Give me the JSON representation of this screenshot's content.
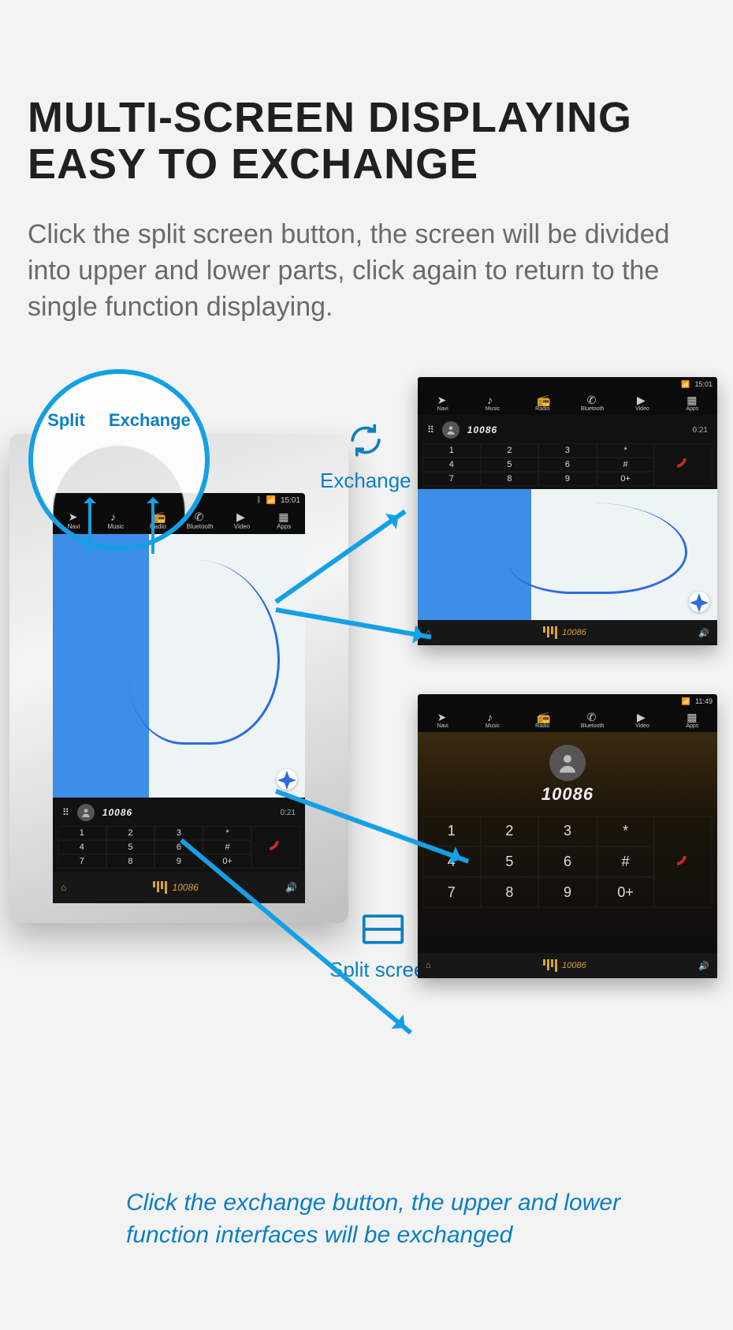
{
  "heading_l1": "MULTI-SCREEN DISPLAYING",
  "heading_l2": "EASY TO EXCHANGE",
  "subheading": "Click the split screen button, the screen will be divided into upper and lower parts, click again to return to the single function displaying.",
  "footer_note": "Click the exchange button, the upper and lower function interfaces will be exchanged",
  "callout": {
    "split": "Split",
    "exchange": "Exchange"
  },
  "feature_labels": {
    "exchange": "Exchange",
    "split": "Split screen"
  },
  "nav": {
    "items": [
      {
        "label": "Navi"
      },
      {
        "label": "Music"
      },
      {
        "label": "Radio"
      },
      {
        "label": "Bluetooth"
      },
      {
        "label": "Video"
      },
      {
        "label": "Apps"
      }
    ]
  },
  "status": {
    "time_a": "15:01",
    "time_b": "11:49"
  },
  "dialer": {
    "contact": "10086",
    "duration": "0:21",
    "keys_row1": [
      "1",
      "2",
      "3",
      "*"
    ],
    "keys_row2": [
      "4",
      "5",
      "6",
      "#"
    ],
    "keys_row3": [
      "7",
      "8",
      "9",
      "0+"
    ]
  },
  "nowplaying": "10086"
}
